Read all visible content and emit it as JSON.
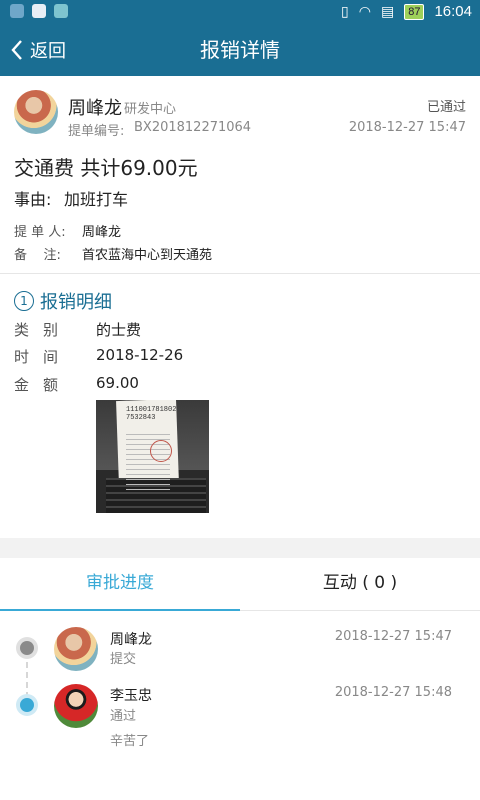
{
  "status_bar": {
    "battery": "87",
    "time": "16:04"
  },
  "nav": {
    "back_label": "返回",
    "title": "报销详情"
  },
  "header": {
    "name": "周峰龙",
    "department": "研发中心",
    "status": "已通过",
    "order_label": "提单编号:",
    "order_number": "BX201812271064",
    "datetime": "2018-12-27 15:47"
  },
  "summary": {
    "title": "交通费 共计69.00元",
    "reason_label": "事由:",
    "reason": "加班打车",
    "submitter_label": "提 单 人:",
    "submitter": "周峰龙",
    "note_label": "备    注:",
    "note": "首农蓝海中心到天通苑"
  },
  "detail": {
    "index": "1",
    "title": "报销明细",
    "category_label": "类别",
    "category": "的士费",
    "time_label": "时间",
    "date": "2018-12-26",
    "amount_label": "金额",
    "amount": "69.00",
    "receipt_text": "1110017818027532843"
  },
  "tabs": {
    "progress": "审批进度",
    "interaction": "互动 ( 0 )"
  },
  "timeline": [
    {
      "name": "周峰龙",
      "action": "提交",
      "time": "2018-12-27 15:47",
      "comment": ""
    },
    {
      "name": "李玉忠",
      "action": "通过",
      "time": "2018-12-27 15:48",
      "comment": "辛苦了"
    }
  ]
}
